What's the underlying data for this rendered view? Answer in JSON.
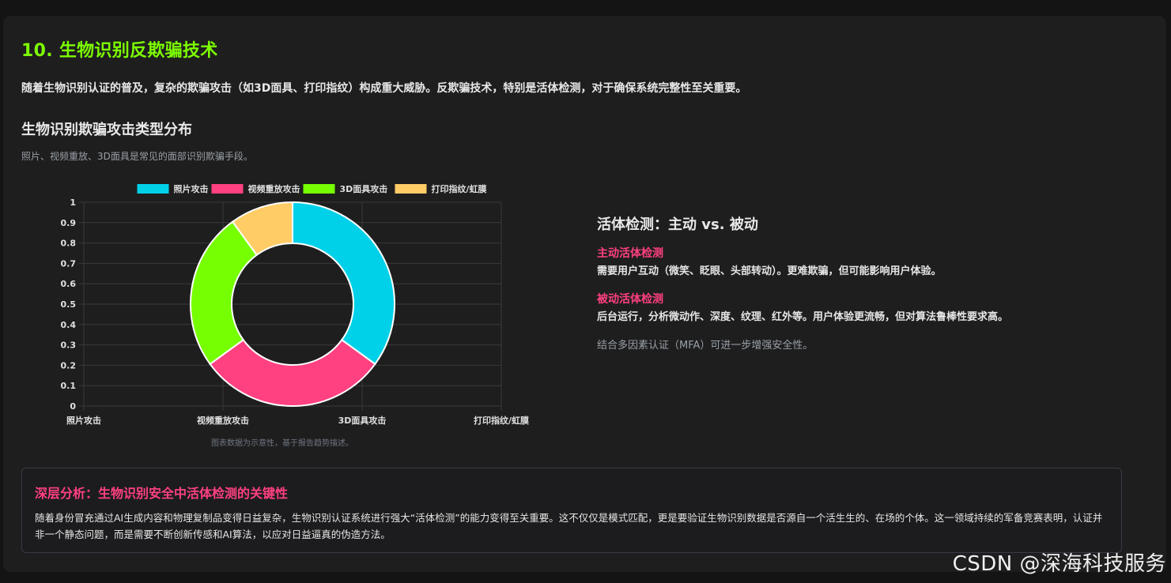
{
  "header": {
    "title": "10. 生物识别反欺骗技术",
    "intro": "随着生物识别认证的普及，复杂的欺骗攻击（如3D面具、打印指纹）构成重大威胁。反欺骗技术，特别是活体检测，对于确保系统完整性至关重要。"
  },
  "chart_section": {
    "title": "生物识别欺骗攻击类型分布",
    "subtitle": "照片、视频重放、3D面具是常见的面部识别欺骗手段。",
    "note": "图表数据为示意性，基于报告趋势描述。"
  },
  "chart_data": {
    "type": "pie",
    "categories": [
      "照片攻击",
      "视频重放攻击",
      "3D面具攻击",
      "打印指纹/虹膜"
    ],
    "values": [
      35,
      30,
      25,
      10
    ],
    "colors": [
      "#00d1e8",
      "#ff4081",
      "#76ff03",
      "#ffcc66"
    ],
    "legend": "top",
    "grid": true,
    "ylim": [
      0,
      1
    ],
    "yticks": [
      "0",
      "0.1",
      "0.2",
      "0.3",
      "0.4",
      "0.5",
      "0.6",
      "0.7",
      "0.8",
      "0.9",
      "1"
    ],
    "xticks": [
      "照片攻击",
      "视频重放攻击",
      "3D面具攻击",
      "打印指纹/虹膜"
    ]
  },
  "liveness": {
    "title": "活体检测：主动 vs. 被动",
    "active_title": "主动活体检测",
    "active_text": "需要用户互动（微笑、眨眼、头部转动）。更难欺骗，但可能影响用户体验。",
    "passive_title": "被动活体检测",
    "passive_text": "后台运行，分析微动作、深度、纹理、红外等。用户体验更流畅，但对算法鲁棒性要求高。",
    "note": "结合多因素认证（MFA）可进一步增强安全性。"
  },
  "analysis": {
    "title": "深层分析：生物识别安全中活体检测的关键性",
    "text": "随着身份冒充通过AI生成内容和物理复制品变得日益复杂，生物识别认证系统进行强大“活体检测”的能力变得至关重要。这不仅仅是模式匹配，更是要验证生物识别数据是否源自一个活生生的、在场的个体。这一领域持续的军备竞赛表明，认证并非一个静态问题，而是需要不断创新传感和AI算法，以应对日益逼真的伪造方法。"
  },
  "watermark": "CSDN @深海科技服务"
}
